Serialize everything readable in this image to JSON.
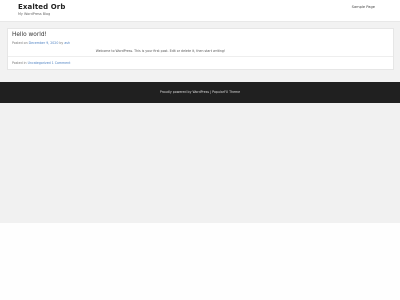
{
  "header": {
    "site_title": "Exalted Orb",
    "site_description": "My WordPress Blog",
    "nav": [
      "Sample Page"
    ]
  },
  "post": {
    "title": "Hello world!",
    "meta_prefix": "Posted on",
    "date": "December 9, 2020",
    "by": "by",
    "author": "ash",
    "content": "Welcome to WordPress. This is your first post. Edit or delete it, then start writing!",
    "posted_in": "Posted in",
    "category": "Uncategorized",
    "comments": "1 Comment"
  },
  "footer": {
    "text": "Proudly powered by WordPress | PopularFX Theme"
  }
}
